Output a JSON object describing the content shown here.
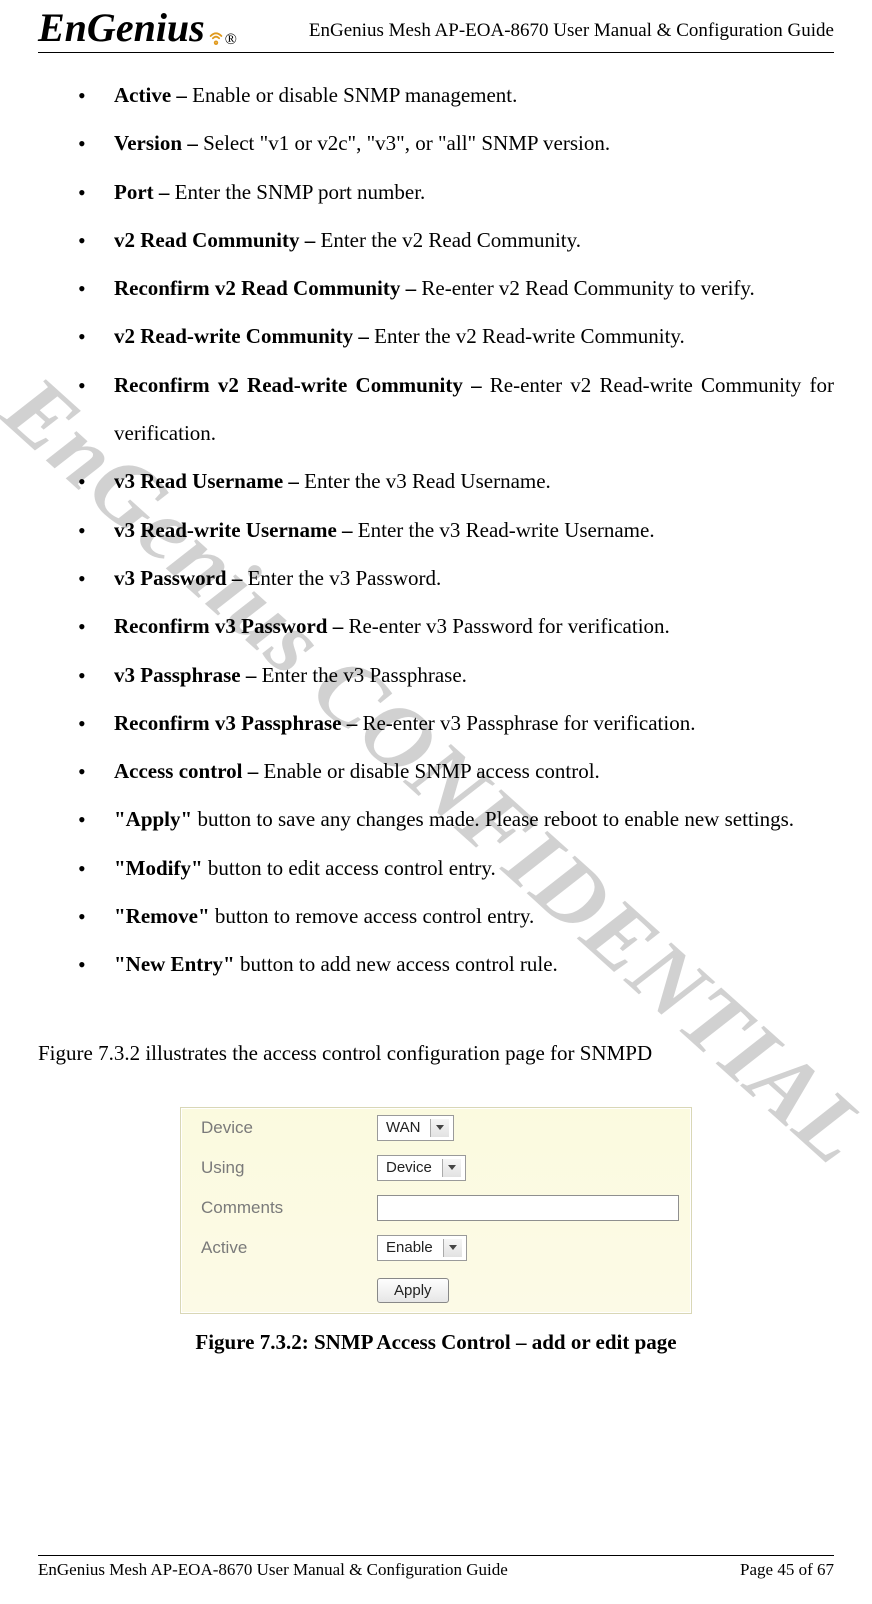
{
  "header": {
    "logo_text": "EnGenius",
    "trademark": "®",
    "title": "EnGenius Mesh AP-EOA-8670 User Manual & Configuration Guide"
  },
  "watermark": "EnGenius CONFIDENTIAL",
  "bullets": [
    {
      "bold": "Active – ",
      "rest": "Enable or disable SNMP management."
    },
    {
      "bold": "Version – ",
      "rest": "Select \"v1 or v2c\", \"v3\", or \"all\" SNMP version."
    },
    {
      "bold": "Port – ",
      "rest": "Enter the SNMP port number."
    },
    {
      "bold": "v2 Read Community – ",
      "rest": "Enter the v2 Read Community."
    },
    {
      "bold": "Reconfirm v2 Read Community – ",
      "rest": "Re-enter v2 Read Community to verify."
    },
    {
      "bold": "v2 Read-write Community – ",
      "rest": "Enter the v2 Read-write Community."
    },
    {
      "bold": "Reconfirm v2 Read-write Community – ",
      "rest": "Re-enter v2 Read-write Community for verification."
    },
    {
      "bold": "v3 Read Username – ",
      "rest": "Enter the v3 Read Username."
    },
    {
      "bold": "v3 Read-write Username – ",
      "rest": "Enter the v3 Read-write Username."
    },
    {
      "bold": "v3 Password – ",
      "rest": "Enter the v3 Password."
    },
    {
      "bold": "Reconfirm v3 Password – ",
      "rest": "Re-enter v3 Password for verification."
    },
    {
      "bold": "v3 Passphrase – ",
      "rest": "Enter the v3 Passphrase."
    },
    {
      "bold": "Reconfirm v3 Passphrase – ",
      "rest": "Re-enter v3 Passphrase for verification."
    },
    {
      "bold": "Access control – ",
      "rest": "Enable or disable SNMP access control."
    },
    {
      "bold": "\"Apply\"",
      "rest": " button to save any changes made. Please reboot to enable new settings."
    },
    {
      "bold": "\"Modify\"",
      "rest": " button to edit access control entry."
    },
    {
      "bold": "\"Remove\"",
      "rest": " button to remove access control entry."
    },
    {
      "bold": "\"New Entry\"",
      "rest": " button to add new access control rule."
    }
  ],
  "intro": "Figure 7.3.2 illustrates the access control configuration page for SNMPD",
  "figure": {
    "fields": {
      "device_label": "Device",
      "device_value": "WAN",
      "using_label": "Using",
      "using_value": "Device",
      "comments_label": "Comments",
      "comments_value": "",
      "active_label": "Active",
      "active_value": "Enable",
      "apply_label": "Apply"
    },
    "caption": "Figure 7.3.2: SNMP Access Control – add or edit page"
  },
  "footer": {
    "left": "EnGenius Mesh AP-EOA-8670 User Manual & Configuration Guide",
    "right": "Page 45 of 67"
  }
}
